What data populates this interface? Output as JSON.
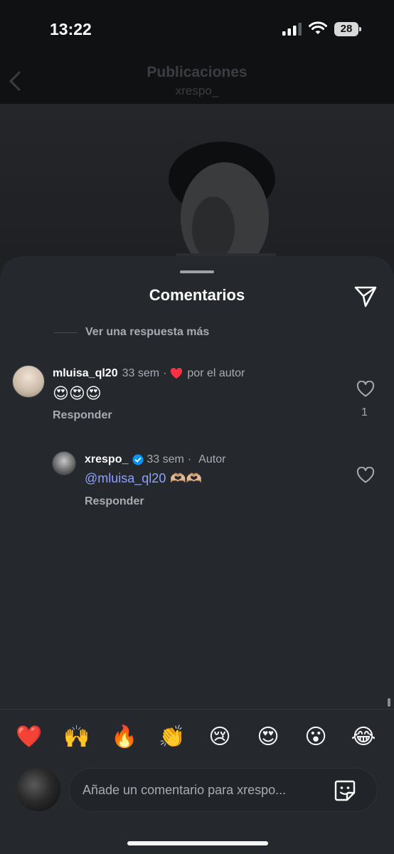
{
  "status_bar": {
    "time": "13:22",
    "battery": "28"
  },
  "header": {
    "title": "Publicaciones",
    "subtitle": "xrespo_"
  },
  "sheet": {
    "title": "Comentarios",
    "view_more": "Ver una respuesta más"
  },
  "comments": [
    {
      "username": "mluisa_ql20",
      "time": "33 sem",
      "liked_by_author": "por el autor",
      "text": "😍😍😍",
      "reply_label": "Responder",
      "like_count": "1"
    },
    {
      "username": "xrespo_",
      "time": "33 sem",
      "author_label": "Autor",
      "mention": "@mluisa_ql20",
      "text": "🫶🏼🫶🏼",
      "reply_label": "Responder"
    }
  ],
  "reactions": [
    "❤️",
    "🙌",
    "🔥",
    "👏",
    "😢",
    "😍",
    "😮",
    "😂"
  ],
  "composer": {
    "placeholder": "Añade un comentario para xrespo..."
  },
  "colors": {
    "accent_mention": "#8ea2ff",
    "heart_red": "#ff3040",
    "verified_blue": "#0095f6"
  }
}
